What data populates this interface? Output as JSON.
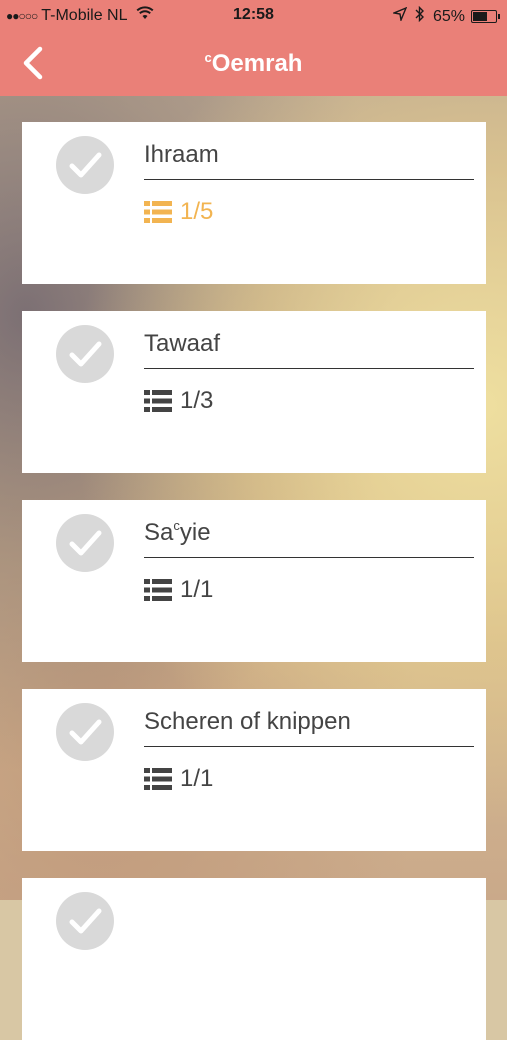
{
  "status_bar": {
    "signal": "●●○○○",
    "carrier": "T-Mobile NL",
    "time": "12:58",
    "battery_percent": "65%",
    "battery_level": 0.65,
    "icons": [
      "wifi-icon",
      "location-arrow-icon",
      "bluetooth-icon",
      "battery-icon"
    ]
  },
  "nav": {
    "title_superscript": "c",
    "title": "Oemrah",
    "back_icon": "chevron-left-icon"
  },
  "colors": {
    "header": "#ea8078",
    "active_progress": "#f2b451",
    "check_circle": "#d9d9d9"
  },
  "steps": [
    {
      "title_before": "Ihraam",
      "title_sup": "",
      "title_after": "",
      "progress": "1/5",
      "active": true
    },
    {
      "title_before": "Tawaaf",
      "title_sup": "",
      "title_after": "",
      "progress": "1/3",
      "active": false
    },
    {
      "title_before": "Sa",
      "title_sup": "c",
      "title_after": "yie",
      "progress": "1/1",
      "active": false
    },
    {
      "title_before": "Scheren of knippen",
      "title_sup": "",
      "title_after": "",
      "progress": "1/1",
      "active": false
    }
  ]
}
